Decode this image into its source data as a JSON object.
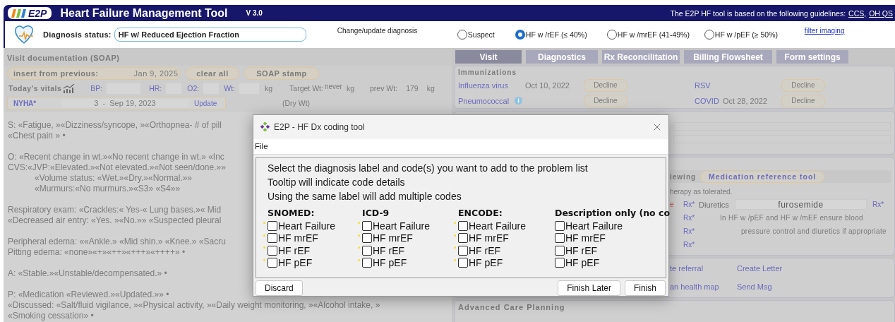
{
  "header": {
    "logo": "E2P",
    "title": "Heart Failure Management Tool",
    "version": "V 3.0",
    "guidelines": "The E2P HF tool is based on the following guidelines:",
    "links": [
      "CCS,",
      "OH QS"
    ]
  },
  "diagnosis": {
    "label": "Diagnosis status:",
    "value": "HF w/ Reduced Ejection Fraction",
    "change_label": "Change/update diagnosis",
    "options": [
      {
        "label": "Suspect",
        "selected": false
      },
      {
        "label": "HF w /rEF (≤ 40%)",
        "selected": true
      },
      {
        "label": "HF w /mrEF (41-49%)",
        "selected": false
      },
      {
        "label": "HF w /pEF (≥ 50%)",
        "selected": false
      }
    ],
    "link": "filter imaging"
  },
  "soap": {
    "title": "Visit documentation (SOAP)",
    "insert_label": "insert from previous:",
    "insert_date": "Jan 9, 2025",
    "buttons": [
      "clear all",
      "SOAP stamp"
    ],
    "vitals": {
      "label": "Today's vitals",
      "fields": [
        {
          "label": "BP:"
        },
        {
          "label": "HR:"
        },
        {
          "label": "O2:"
        },
        {
          "label": "Wt:",
          "unit": "kg"
        }
      ],
      "target": {
        "label": "Target Wt:",
        "value": "never",
        "unit": "kg",
        "note": "(Dry Wt)"
      },
      "previous": {
        "label": "prev Wt:",
        "value": "179",
        "unit": "kg"
      }
    },
    "nyha": {
      "label": "NYHA*",
      "value": "3  -  Sep 19, 2023",
      "button": "Update"
    },
    "paragraphs": [
      [
        {
          "text": "S: «Fatigue, »«Dizziness/syncope, »«Orthopnea- # of pill"
        },
        {
          "text": "«Chest pain » •"
        }
      ],
      [
        {
          "text": "O: «Recent change in wt.»«No recent change in wt.» «Inc"
        },
        {
          "text": "CVS:«JVP:«Elevated.»«Not elevated.»«Not seen/done.»»",
          "children": [
            {
              "text": "«Volume status: «Wet.»«Dry.»«Normal.»»"
            },
            {
              "text": "«Murmurs:«No murmurs.»«S3» «S4»»"
            }
          ]
        }
      ],
      [
        {
          "text": "Respiratory exam: «Crackles:« Yes-« Lung bases.»« Mid"
        },
        {
          "text": "«Decreased air entry: «Yes. »«No.»» «Suspected pleural"
        }
      ],
      [
        {
          "text": "Peripheral edema: ««Ankle.» «Mid shin.» «Knee.» «Sacru"
        },
        {
          "text": "Pitting edema: «none»«+»«++»«+++»«++++» •"
        }
      ],
      [
        {
          "text": "A: «Stable.»«Unstable/decompensated.» •"
        }
      ],
      [
        {
          "text": "P: «Medication «Reviewed.»«Updated.»» •"
        },
        {
          "text": "«Discussed: «Salt/fluid vigilance, »«Physical activity, »«Daily weight monitoring, »«Alcohol intake, »"
        },
        {
          "text": "«Smoking cessation» •"
        }
      ]
    ]
  },
  "tabs": [
    {
      "label": "Visit",
      "selected": true
    },
    {
      "label": "Diagnostics",
      "selected": false
    },
    {
      "label": "Rx Reconcilitation",
      "selected": false
    },
    {
      "label": "Billing Flowsheet",
      "selected": false
    },
    {
      "label": "Form settings",
      "selected": false
    }
  ],
  "immunizations": {
    "title": "Immunizations",
    "items": [
      {
        "name": "Influenza virus",
        "date": "Oct 10, 2022",
        "button": "Decline",
        "info": false
      },
      {
        "name": "RSV",
        "button": "Decline",
        "info": false
      },
      {
        "name": "Pneumococcal",
        "button": "Decline",
        "info": true
      },
      {
        "name": "COVID",
        "date": "Oct 28, 2022",
        "button": "Decline",
        "info": false
      }
    ]
  },
  "medications": {
    "heading": "iewing",
    "tool_button": "Medication reference tool",
    "note": "herapy as tolerated.",
    "rows": [
      {
        "marker": "e",
        "link": "Rx*",
        "label": "Diuretics",
        "value": "furosemide",
        "end_link": "Rx*"
      },
      {
        "link": "Rx*",
        "text": "In HF w /pEF and HF w /mEF ensure blood"
      },
      {
        "link": "Rx*",
        "text": "pressure control and diuretics if appropriate"
      },
      {
        "link": "Rx*"
      }
    ]
  },
  "actions": [
    [
      "te referral",
      "Create Letter"
    ],
    [
      "an health map",
      "Send Msg"
    ]
  ],
  "advanced_care_planning": "Advanced Care Planning",
  "dialog": {
    "title": "E2P - HF Dx coding tool",
    "menu": [
      "File"
    ],
    "instructions": [
      "Select the diagnosis label and code(s) you want to add to the problem list",
      "Tooltip will indicate code details",
      "Using the same label will add multiple codes"
    ],
    "columns": [
      {
        "heading": "SNOMED:",
        "options": [
          {
            "label": "Heart Failure",
            "checked": false,
            "flagged": true
          },
          {
            "label": "HF mrEF",
            "checked": false,
            "flagged": true
          },
          {
            "label": "HF rEF",
            "checked": false,
            "flagged": true
          },
          {
            "label": "HF pEF",
            "checked": false,
            "flagged": true
          }
        ]
      },
      {
        "heading": "ICD-9",
        "options": [
          {
            "label": "Heart Failure",
            "checked": false,
            "flagged": true
          },
          {
            "label": "HF mrEF",
            "checked": false,
            "flagged": true
          },
          {
            "label": "HF rEF",
            "checked": false,
            "flagged": true
          },
          {
            "label": "HF pEF",
            "checked": false,
            "flagged": true
          }
        ]
      },
      {
        "heading": "ENCODE:",
        "options": [
          {
            "label": "Heart Failure",
            "checked": false,
            "flagged": true
          },
          {
            "label": "HF mrEF",
            "checked": false,
            "flagged": true
          },
          {
            "label": "HF rEF",
            "checked": false,
            "flagged": true
          },
          {
            "label": "HF pEF",
            "checked": false,
            "flagged": true
          }
        ]
      },
      {
        "heading": "Description only (no co",
        "options": [
          {
            "label": "Heart Failure",
            "checked": false,
            "flagged": false
          },
          {
            "label": "HF mrEF",
            "checked": false,
            "flagged": false
          },
          {
            "label": "HF rEF",
            "checked": false,
            "flagged": false
          },
          {
            "label": "HF pEF",
            "checked": false,
            "flagged": false
          }
        ]
      }
    ],
    "buttons_left": [
      "Discard"
    ],
    "buttons_right": [
      "Finish Later",
      "Finish"
    ]
  }
}
